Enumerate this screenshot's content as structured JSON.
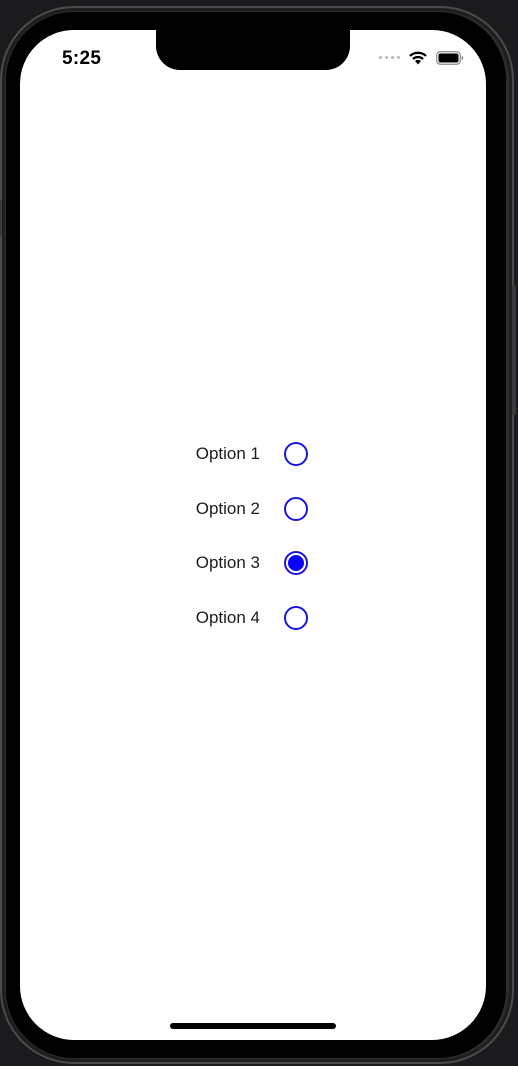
{
  "status_bar": {
    "time": "5:25",
    "icons": [
      "signal-dots-icon",
      "wifi-icon",
      "battery-icon"
    ]
  },
  "radio_group": {
    "accent_color": "#1b16d6",
    "options": [
      {
        "label": "Option 1",
        "selected": false
      },
      {
        "label": "Option 2",
        "selected": false
      },
      {
        "label": "Option 3",
        "selected": true
      },
      {
        "label": "Option 4",
        "selected": false
      }
    ]
  }
}
